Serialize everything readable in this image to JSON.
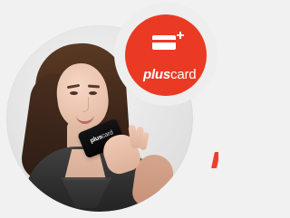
{
  "promo": {
    "brand_prefix": "plus",
    "brand_suffix": "card",
    "held_card_prefix": "plus",
    "held_card_suffix": "card"
  },
  "icons": {
    "badge_icon": "card-plus-icon"
  },
  "colors": {
    "background": "#f1f1f1",
    "badge_outer": "#eeeeee",
    "badge_inner": "#ea3a24",
    "brand_text": "#ffffff",
    "accent_edge": "#ef3d2d"
  }
}
